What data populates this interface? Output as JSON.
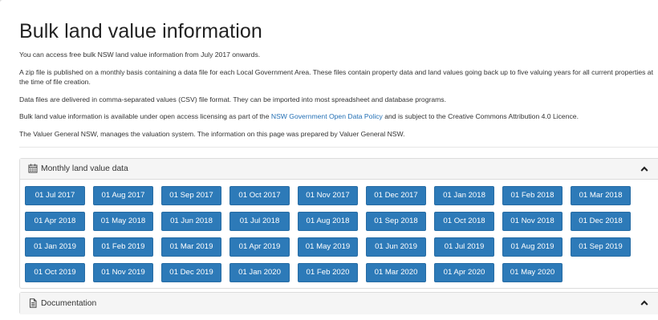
{
  "page": {
    "title": "Bulk land value information",
    "paragraphs": [
      "You can access free bulk NSW land value information from July 2017 onwards.",
      "A zip file is published on a monthly basis containing a data file for each Local Government Area. These files contain property data and land values going back up to five valuing years for all current properties at the time of file creation.",
      "Data files are delivered in comma-separated values (CSV) file format. They can be imported into most spreadsheet and database programs."
    ],
    "licence": {
      "before": "Bulk land value information is available under open access licensing as part of the ",
      "link": "NSW Government Open Data Policy",
      "after": " and is subject to the Creative Commons Attribution 4.0 Licence."
    },
    "valuer_note": "The Valuer General NSW, manages the valuation system. The information on this page was prepared by Valuer General NSW."
  },
  "monthly_panel": {
    "icon": "calendar-icon",
    "title": "Monthly land value data",
    "toggle_icon": "chevron-up-icon",
    "buttons": [
      "01 Jul 2017",
      "01 Aug 2017",
      "01 Sep 2017",
      "01 Oct 2017",
      "01 Nov 2017",
      "01 Dec 2017",
      "01 Jan 2018",
      "01 Feb 2018",
      "01 Mar 2018",
      "01 Apr 2018",
      "01 May 2018",
      "01 Jun 2018",
      "01 Jul 2018",
      "01 Aug 2018",
      "01 Sep 2018",
      "01 Oct 2018",
      "01 Nov 2018",
      "01 Dec 2018",
      "01 Jan 2019",
      "01 Feb 2019",
      "01 Mar 2019",
      "01 Apr 2019",
      "01 May 2019",
      "01 Jun 2019",
      "01 Jul 2019",
      "01 Aug 2019",
      "01 Sep 2019",
      "01 Oct 2019",
      "01 Nov 2019",
      "01 Dec 2019",
      "01 Jan 2020",
      "01 Feb 2020",
      "01 Mar 2020",
      "01 Apr 2020",
      "01 May 2020"
    ]
  },
  "documentation_panel": {
    "icon": "document-icon",
    "title": "Documentation",
    "toggle_icon": "chevron-up-icon"
  },
  "colors": {
    "button_bg": "#2d7ab8",
    "link": "#2470b5",
    "panel_header_bg": "#f5f5f5"
  }
}
